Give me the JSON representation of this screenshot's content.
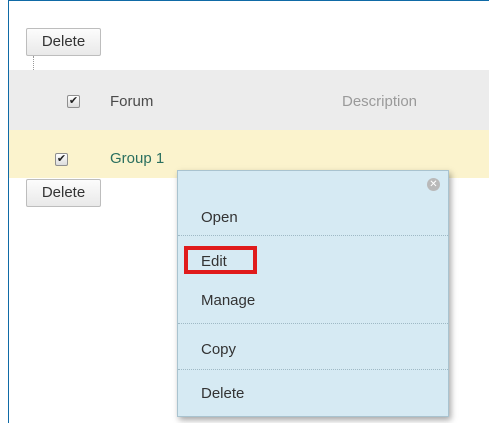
{
  "toolbar": {
    "delete_label": "Delete"
  },
  "table": {
    "columns": [
      "Forum",
      "Description"
    ],
    "rows": [
      {
        "forum": "Group 1"
      }
    ]
  },
  "context_menu": {
    "items": [
      "Open",
      "Edit",
      "Manage",
      "Copy",
      "Delete"
    ],
    "highlighted_item": "Edit"
  },
  "colors": {
    "header_row": "#ececec",
    "selected_row": "#fbf3cd",
    "menu_bg": "#d6eaf3",
    "highlight": "#e01b1b",
    "link": "#2a6f5f",
    "frame_border": "#0f6aa6"
  },
  "icons": {
    "checkbox": "checkmark",
    "menu_close": "close-icon"
  }
}
